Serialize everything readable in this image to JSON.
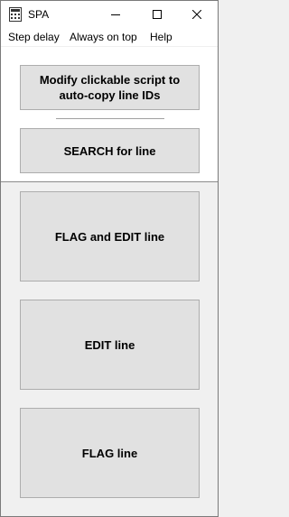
{
  "window": {
    "title": "SPA",
    "icon": "calculator-grid-icon"
  },
  "titlebar_controls": {
    "minimize_icon": "minimize-icon",
    "maximize_icon": "maximize-icon",
    "close_icon": "close-icon"
  },
  "menubar": {
    "items": [
      {
        "label": "Step delay"
      },
      {
        "label": "Always on top"
      },
      {
        "label": "Help"
      }
    ]
  },
  "upper_panel": {
    "modify_button_label": "Modify clickable script to\nauto-copy line IDs",
    "search_button_label": "SEARCH for line"
  },
  "lower_panel": {
    "flag_edit_button_label": "FLAG and EDIT line",
    "edit_button_label": "EDIT line",
    "flag_button_label": "FLAG line"
  },
  "colors": {
    "window_bg": "#f0f0f0",
    "panel_bg": "#ffffff",
    "button_face": "#e1e1e1",
    "button_border": "#adadad"
  }
}
